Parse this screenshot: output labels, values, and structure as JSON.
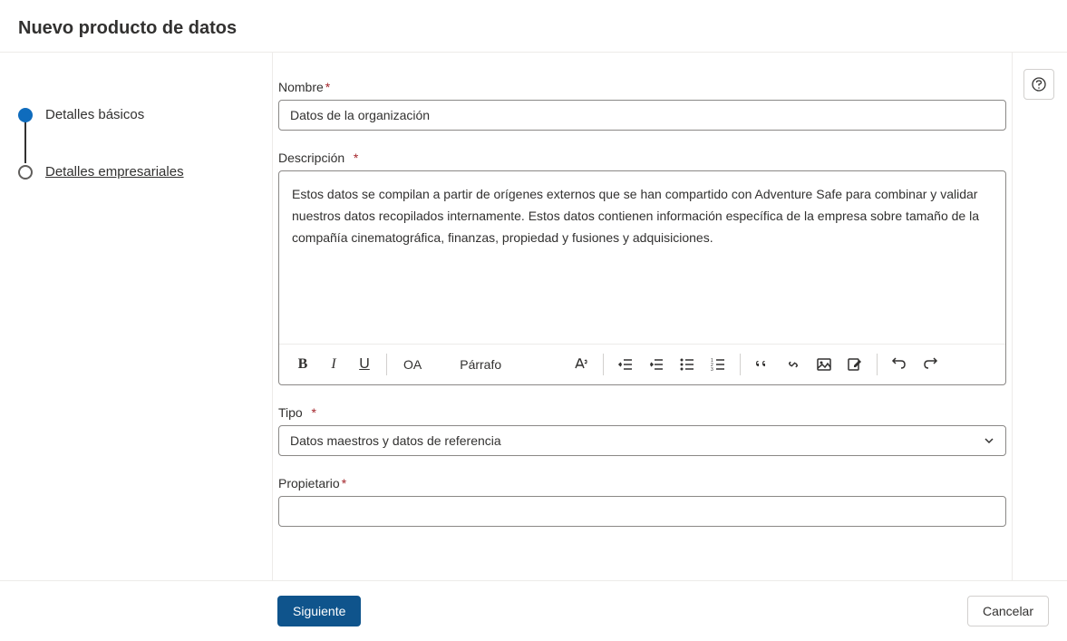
{
  "header": {
    "title": "Nuevo producto de datos"
  },
  "steps": [
    {
      "label": "Detalles básicos",
      "active": true
    },
    {
      "label": "Detalles empresariales",
      "active": false
    }
  ],
  "form": {
    "name": {
      "label": "Nombre",
      "value": "Datos de la organización"
    },
    "description": {
      "label": "Descripción",
      "value": "Estos datos se compilan a partir de orígenes externos que se han compartido con Adventure Safe para combinar y validar nuestros datos recopilados internamente.    Estos datos contienen información específica de la empresa sobre tamaño de la compañía cinematográfica, finanzas, propiedad y fusiones y adquisiciones."
    },
    "type": {
      "label": "Tipo",
      "value": "Datos maestros y datos de referencia"
    },
    "owner": {
      "label": "Propietario",
      "value": ""
    }
  },
  "toolbar": {
    "font_label": "OA",
    "paragraph_label": "Párrafo"
  },
  "footer": {
    "next": "Siguiente",
    "cancel": "Cancelar"
  }
}
